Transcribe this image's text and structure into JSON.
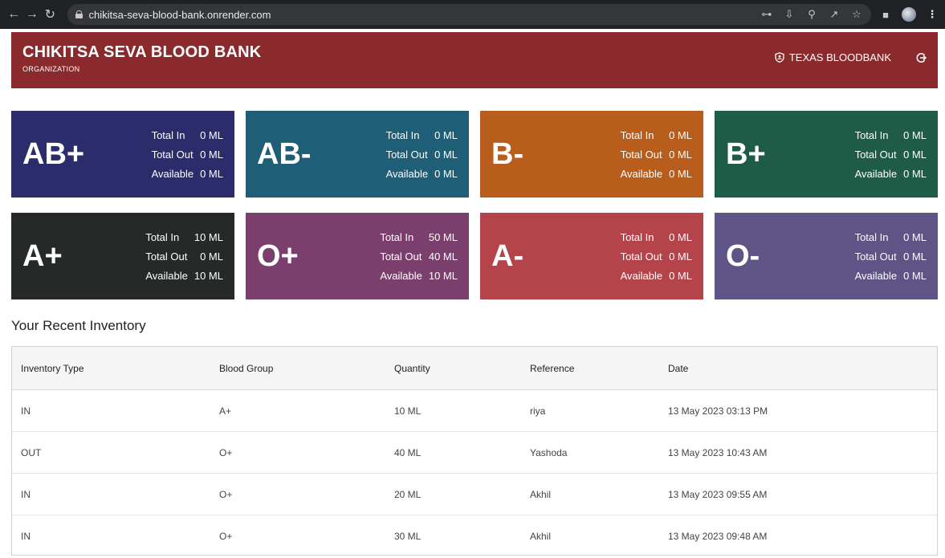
{
  "browser": {
    "url": "chikitsa-seva-blood-bank.onrender.com"
  },
  "header": {
    "title": "CHIKITSA SEVA BLOOD BANK",
    "subtitle": "ORGANIZATION",
    "user": "TEXAS BLOODBANK"
  },
  "cards": [
    {
      "group": "AB+",
      "color": "#2b2c6b",
      "total_in_label": "Total In",
      "total_in": "0 ML",
      "total_out_label": "Total Out",
      "total_out": "0 ML",
      "available_label": "Available",
      "available": "0 ML"
    },
    {
      "group": "AB-",
      "color": "#1e5e77",
      "total_in_label": "Total In",
      "total_in": "0 ML",
      "total_out_label": "Total Out",
      "total_out": "0 ML",
      "available_label": "Available",
      "available": "0 ML"
    },
    {
      "group": "B-",
      "color": "#b85d1c",
      "total_in_label": "Total In",
      "total_in": "0 ML",
      "total_out_label": "Total Out",
      "total_out": "0 ML",
      "available_label": "Available",
      "available": "0 ML"
    },
    {
      "group": "B+",
      "color": "#1f5c47",
      "total_in_label": "Total In",
      "total_in": "0 ML",
      "total_out_label": "Total Out",
      "total_out": "0 ML",
      "available_label": "Available",
      "available": "0 ML"
    },
    {
      "group": "A+",
      "color": "#252a28",
      "total_in_label": "Total In",
      "total_in": "10 ML",
      "total_out_label": "Total Out",
      "total_out": "0 ML",
      "available_label": "Available",
      "available": "10 ML"
    },
    {
      "group": "O+",
      "color": "#7a3f6c",
      "total_in_label": "Total In",
      "total_in": "50 ML",
      "total_out_label": "Total Out",
      "total_out": "40 ML",
      "available_label": "Available",
      "available": "10 ML"
    },
    {
      "group": "A-",
      "color": "#b5444a",
      "total_in_label": "Total In",
      "total_in": "0 ML",
      "total_out_label": "Total Out",
      "total_out": "0 ML",
      "available_label": "Available",
      "available": "0 ML"
    },
    {
      "group": "O-",
      "color": "#5e5486",
      "total_in_label": "Total In",
      "total_in": "0 ML",
      "total_out_label": "Total Out",
      "total_out": "0 ML",
      "available_label": "Available",
      "available": "0 ML"
    }
  ],
  "inventory": {
    "title": "Your Recent Inventory",
    "columns": [
      "Inventory Type",
      "Blood Group",
      "Quantity",
      "Reference",
      "Date"
    ],
    "rows": [
      [
        "IN",
        "A+",
        "10 ML",
        "riya",
        "13 May 2023 03:13 PM"
      ],
      [
        "OUT",
        "O+",
        "40 ML",
        "Yashoda",
        "13 May 2023 10:43 AM"
      ],
      [
        "IN",
        "O+",
        "20 ML",
        "Akhil",
        "13 May 2023 09:55 AM"
      ],
      [
        "IN",
        "O+",
        "30 ML",
        "Akhil",
        "13 May 2023 09:48 AM"
      ]
    ]
  },
  "icons": {
    "back": "arrow-left-icon",
    "forward": "arrow-right-icon",
    "reload": "reload-icon",
    "lock": "lock-icon",
    "key": "key-icon",
    "install": "install-icon",
    "zoom": "zoom-icon",
    "share": "share-icon",
    "star": "star-icon",
    "sidepanel": "side-panel-icon",
    "profile": "profile-avatar",
    "menu": "kebab-menu-icon",
    "shield": "shield-icon",
    "logout": "logout-icon"
  }
}
